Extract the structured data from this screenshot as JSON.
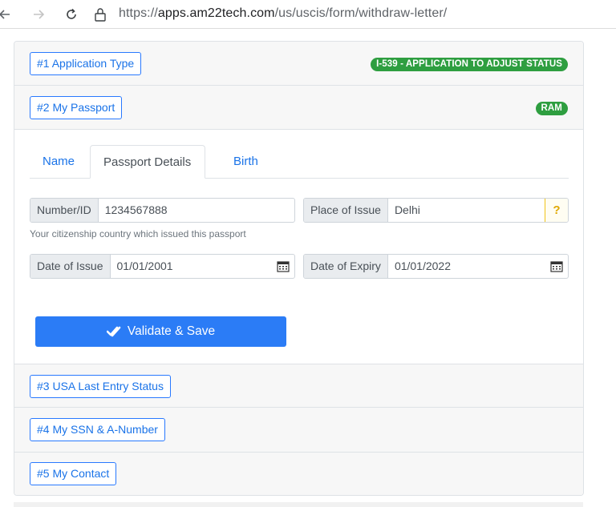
{
  "browser": {
    "url_scheme": "https://",
    "url_host": "apps.am22tech.com",
    "url_path": "/us/uscis/form/withdraw-letter/"
  },
  "accordion": {
    "sections": [
      {
        "label": "#1 Application Type",
        "badge": "I-539 - APPLICATION TO ADJUST STATUS"
      },
      {
        "label": "#2 My Passport",
        "badge": "RAM"
      },
      {
        "label": "#3 USA Last Entry Status"
      },
      {
        "label": "#4 My SSN & A-Number"
      },
      {
        "label": "#5 My Contact"
      }
    ]
  },
  "passport": {
    "tabs": [
      "Name",
      "Passport Details",
      "Birth"
    ],
    "active_tab": "Passport Details",
    "number_label": "Number/ID",
    "number_value": "1234567888",
    "place_label": "Place of Issue",
    "place_value": "Delhi",
    "help_symbol": "?",
    "hint": "Your citizenship country which issued this passport",
    "issue_label": "Date of Issue",
    "issue_value": "01/01/2001",
    "expiry_label": "Date of Expiry",
    "expiry_value": "01/01/2022",
    "validate_label": "Validate & Save"
  },
  "colors": {
    "accent": "#2b7cf6",
    "badge_green": "#2e9e40",
    "link_blue": "#1a73e8"
  }
}
